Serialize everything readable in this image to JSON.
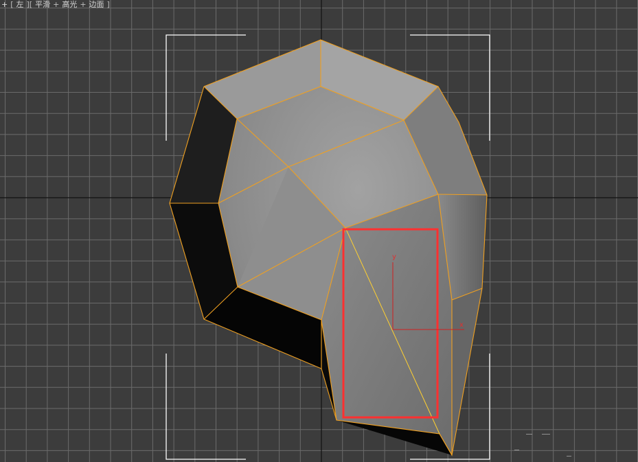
{
  "viewport": {
    "label_menu": [
      {
        "text": "+",
        "name": "viewport-general-menu"
      },
      {
        "text": "[",
        "name": "bracket-open",
        "sep": true
      },
      {
        "text": "左",
        "name": "viewport-view-menu"
      },
      {
        "text": "][",
        "name": "bracket-mid",
        "sep": true
      },
      {
        "text": "平滑",
        "name": "viewport-shading-smooth"
      },
      {
        "text": "+",
        "name": "plus-separator-1",
        "sep": true
      },
      {
        "text": "高光",
        "name": "viewport-shading-highlights"
      },
      {
        "text": "+",
        "name": "plus-separator-2",
        "sep": true
      },
      {
        "text": "边面",
        "name": "viewport-shading-edged-faces"
      },
      {
        "text": "]",
        "name": "bracket-close",
        "sep": true
      }
    ],
    "gizmo": {
      "x_label": "x",
      "y_label": "y"
    },
    "colors": {
      "background": "#3c3c3c",
      "grid": "#6b6b6b",
      "axis": "#111111",
      "edge": "#f0a020",
      "selection_rect": "#ff3030",
      "gizmo_axis": "#d02020",
      "bracket": "#ffffff"
    },
    "icons": [
      "gizmo-axis-icon",
      "viewport-corner-bracket-icon"
    ]
  }
}
